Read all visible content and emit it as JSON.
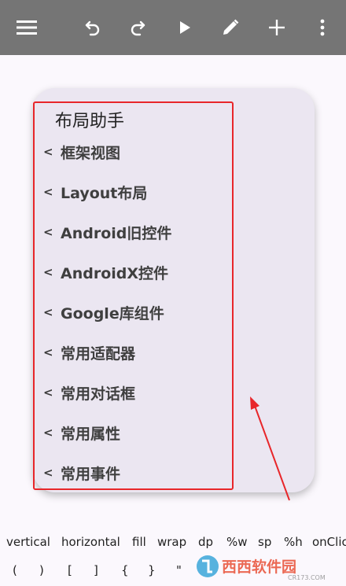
{
  "toolbar": {
    "icons": [
      "menu-icon",
      "undo-icon",
      "redo-icon",
      "play-icon",
      "pencil-icon",
      "plus-icon",
      "more-vert-icon"
    ],
    "background": "#757575"
  },
  "panel": {
    "title": "布局助手",
    "items": [
      {
        "chevron": "<",
        "label": "框架视图"
      },
      {
        "chevron": "<",
        "label": "Layout布局"
      },
      {
        "chevron": "<",
        "label": "Android旧控件"
      },
      {
        "chevron": "<",
        "label": "AndroidX控件"
      },
      {
        "chevron": "<",
        "label": "Google库组件"
      },
      {
        "chevron": "<",
        "label": "常用适配器"
      },
      {
        "chevron": "<",
        "label": "常用对话框"
      },
      {
        "chevron": "<",
        "label": "常用属性"
      },
      {
        "chevron": "<",
        "label": "常用事件"
      }
    ]
  },
  "shortcuts": {
    "words": [
      "vertical",
      "horizontal",
      "fill",
      "wrap",
      "dp",
      "%w",
      "sp",
      "%h",
      "onClic"
    ],
    "symbols": [
      "(",
      ")",
      "[",
      "]",
      "{",
      "}",
      "\""
    ]
  },
  "watermark": {
    "brand": "西西软件园",
    "site": "CR173.COM"
  },
  "colors": {
    "annotation_red": "#e8262a",
    "panel_bg": "#ebe6f1",
    "page_bg": "#fbf8fd"
  }
}
